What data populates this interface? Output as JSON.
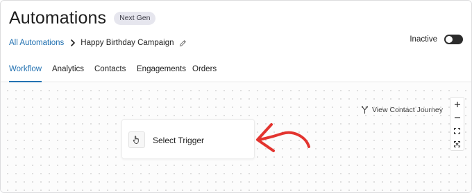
{
  "header": {
    "title": "Automations",
    "badge": "Next Gen"
  },
  "breadcrumb": {
    "root": "All Automations",
    "current": "Happy Birthday Campaign",
    "separator_icon": "chevron-right-icon",
    "edit_icon": "pencil-icon"
  },
  "status": {
    "label": "Inactive",
    "enabled": false
  },
  "tabs": [
    {
      "label": "Workflow",
      "active": true
    },
    {
      "label": "Analytics",
      "active": false
    },
    {
      "label": "Contacts",
      "active": false
    },
    {
      "label": "Engagements",
      "active": false
    },
    {
      "label": "Orders",
      "active": false
    }
  ],
  "canvas": {
    "journey_label": "View Contact Journey",
    "journey_icon": "branch-icon",
    "zoom_controls": [
      "zoom-in-icon",
      "zoom-out-icon",
      "fit-view-icon",
      "fullscreen-icon"
    ],
    "trigger": {
      "label": "Select Trigger",
      "icon": "hand-pointer-icon"
    },
    "annotation_arrow_color": "#e3342f"
  },
  "colors": {
    "accent": "#2271b1",
    "badge_bg": "#e6e6ee",
    "toggle_bg": "#2c2c2c"
  }
}
